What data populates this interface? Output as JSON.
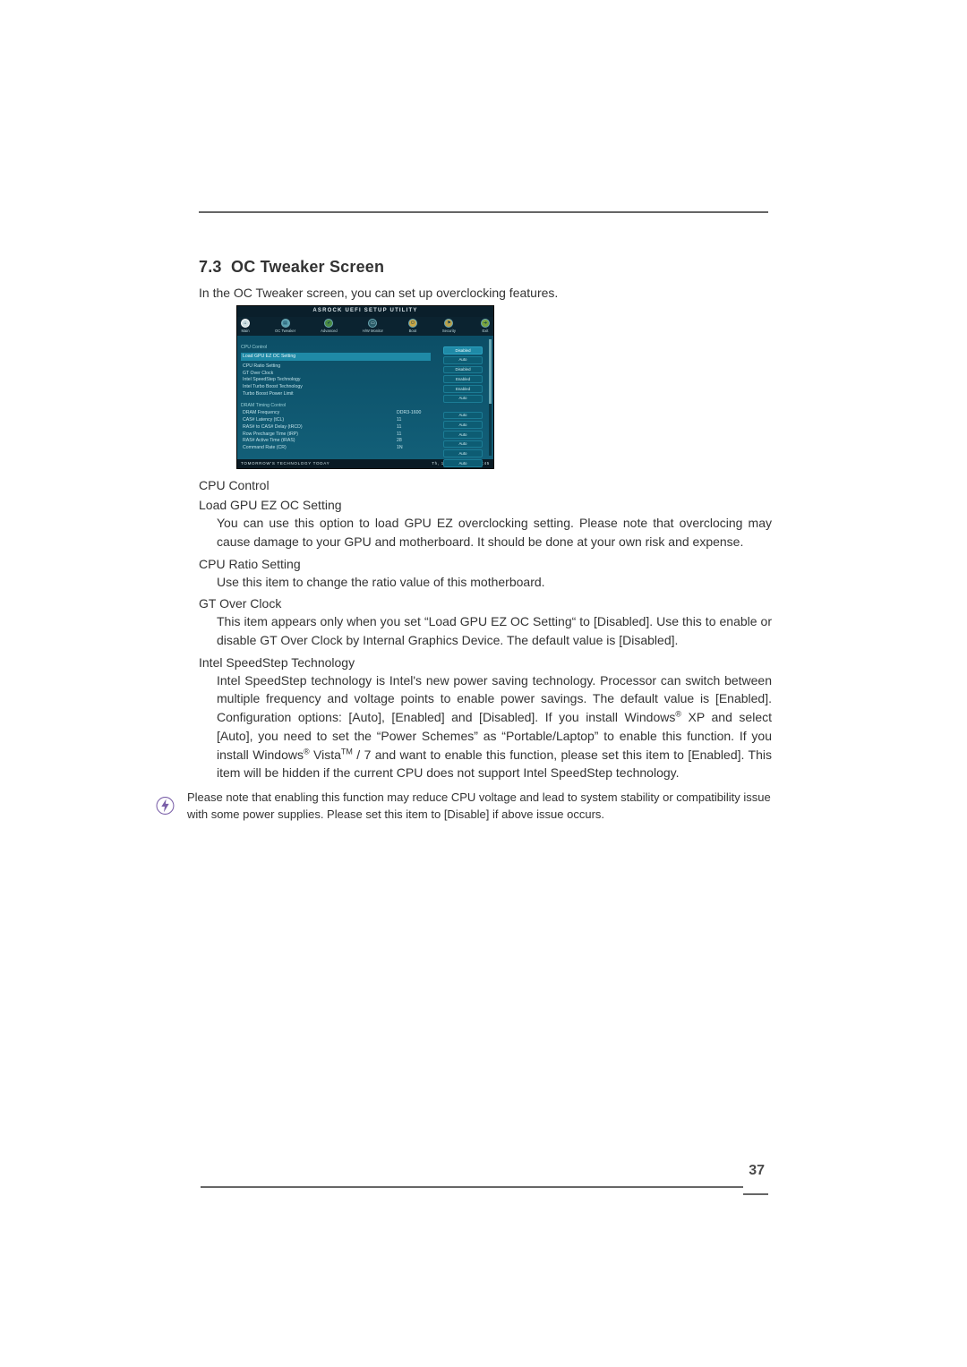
{
  "page_number": "37",
  "section": {
    "num": "7.3",
    "title": "OC Tweaker Screen"
  },
  "intro": "In the OC Tweaker screen, you can set up overclocking features.",
  "bios": {
    "title": "ASROCK UEFI SETUP UTILITY",
    "tabs": [
      "Main",
      "OC Tweaker",
      "Advanced",
      "H/W Monitor",
      "Boot",
      "Security",
      "Exit"
    ],
    "cpu_group": "CPU Control",
    "hl_row": {
      "label": "Load GPU EZ OC Setting",
      "value": "Disabled"
    },
    "dram_group": "DRAM Timing Control",
    "rows_top": [
      {
        "label": "CPU Ratio Setting",
        "pill": "Auto"
      },
      {
        "label": "GT Over Clock",
        "pill": "Disabled"
      },
      {
        "label": "Intel SpeedStep Technology",
        "pill": "Enabled"
      },
      {
        "label": "Intel Turbo Boost Technology",
        "pill": "Enabled"
      },
      {
        "label": "Turbo Boost Power Limit",
        "pill": "Auto"
      }
    ],
    "rows_dram": [
      {
        "label": "DRAM Frequency",
        "mid": "DDR3-1600",
        "pill": "Auto"
      },
      {
        "label": "CAS# Latency (tCL)",
        "mid": "11",
        "pill": "Auto"
      },
      {
        "label": "RAS# to CAS# Delay (tRCD)",
        "mid": "11",
        "pill": "Auto"
      },
      {
        "label": "Row Precharge Time (tRP)",
        "mid": "11",
        "pill": "Auto"
      },
      {
        "label": "RAS# Active Time (tRAS)",
        "mid": "28",
        "pill": "Auto"
      },
      {
        "label": "Command Rate (CR)",
        "mid": "1N",
        "pill": "Auto"
      }
    ],
    "footer_left": "TOMORROW'S TECHNOLOGY TODAY",
    "footer_right": "Th, 10/13/2011  17:55:45"
  },
  "items": {
    "cpu_control": "CPU Control",
    "load_gpu": {
      "head": "Load GPU EZ OC Setting",
      "body": "You can use this option to load GPU EZ overclocking setting. Please note that overclocing may cause damage to your GPU and motherboard. It should be done at your own risk and expense."
    },
    "cpu_ratio": {
      "head": "CPU Ratio Setting",
      "body": "Use this item to change the ratio value of this motherboard."
    },
    "gt_over": {
      "head": "GT Over Clock",
      "body": "This item appears only when you set “Load GPU EZ OC Setting“ to [Disabled]. Use this to enable or disable GT Over Clock by Internal Graphics Device. The default value is [Disabled]."
    },
    "speedstep": {
      "head": "Intel SpeedStep Technology",
      "body_pre_xp": "Intel SpeedStep technology is Intel's new power saving technology. Processor can switch between multiple frequency and voltage points to enable power savings. The default value is [Enabled]. Configuration options: [Auto], [Enabled] and [Disabled]. If you install Windows",
      "body_post_xp": " XP and select [Auto], you need to set the “Power Schemes” as “Portable/Laptop” to enable this function. If you install Windows",
      "body_vista": " Vista",
      "body_tail": " / 7 and want to enable this function, please set this item to [Enabled]. This item will be hidden if the current CPU does not support Intel SpeedStep technology."
    }
  },
  "note": "Please note that enabling this function may reduce CPU voltage and lead to system stability or compatibility issue with some power supplies. Please set this item to [Disable] if above issue occurs."
}
